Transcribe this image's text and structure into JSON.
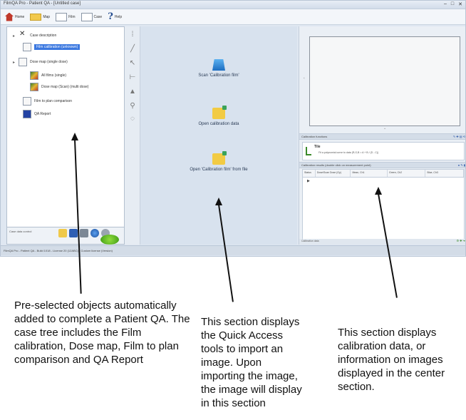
{
  "window": {
    "title": "FilmQA Pro - Patient QA - [Untitled case]",
    "controls": [
      "–",
      "□",
      "✕"
    ]
  },
  "toolbar": {
    "items": [
      {
        "label": "Home",
        "icon": "home-icon"
      },
      {
        "label": "Map",
        "icon": "dose-map-icon"
      },
      {
        "label": "Film",
        "icon": "film-icon"
      },
      {
        "label": "Case",
        "icon": "case-icon"
      },
      {
        "label": "Help",
        "icon": "help-icon"
      }
    ]
  },
  "case_tree": {
    "items": [
      {
        "label": "Case description",
        "icon": "case-icon"
      },
      {
        "label": "Film calibration (unknown)",
        "icon": "film-icon",
        "selected": true
      },
      {
        "label": "Dose map (single dose)",
        "icon": "film-icon"
      },
      {
        "label": "All films (single)",
        "icon": "dose-map-icon"
      },
      {
        "label": "Dose map (Scan) (multi dose)",
        "icon": "dose-map-icon"
      },
      {
        "label": "Film to plan comparison",
        "icon": "film-icon"
      },
      {
        "label": "QA Report",
        "icon": "qa-report-icon"
      }
    ],
    "bottom_label": "Case data control"
  },
  "quick_access": {
    "items": [
      {
        "label": "Scan 'Calibration film'",
        "icon": "scanner-icon"
      },
      {
        "label": "Open calibration data",
        "icon": "open-folder-icon"
      },
      {
        "label": "Open 'Calibration film' from file",
        "icon": "open-folder-icon"
      }
    ]
  },
  "right_panel": {
    "calibration_functions_label": "Calibration functions",
    "calibration": {
      "name": "Tile",
      "description": "Fit a polynomial curve to data  (R,G,B = A + B / (D - C))"
    },
    "calibration_results_label": "Calibration results (double click on measurement point)",
    "table_headers": [
      "Status",
      "Dose/Scan Dose (Gy)",
      "Mean, Ch1",
      "Green, Ch2",
      "Blue, Ch3"
    ],
    "row_marker": "▶",
    "footer_label": "Calibration data"
  },
  "status_bar": {
    "text": "FilmQA Pro - Patient QA - Build 1018 - License 20 (12ABC) - Custom license (Version)"
  },
  "annotations": {
    "left": "Pre-selected objects automatically added to complete a Patient QA. The case tree includes the Film calibration, Dose map, Film to plan comparison and QA Report",
    "center": "This section displays the Quick Access tools to import an image. Upon importing the image, the image will display in this section",
    "right": "This section displays calibration data, or information on images displayed in the center section."
  }
}
